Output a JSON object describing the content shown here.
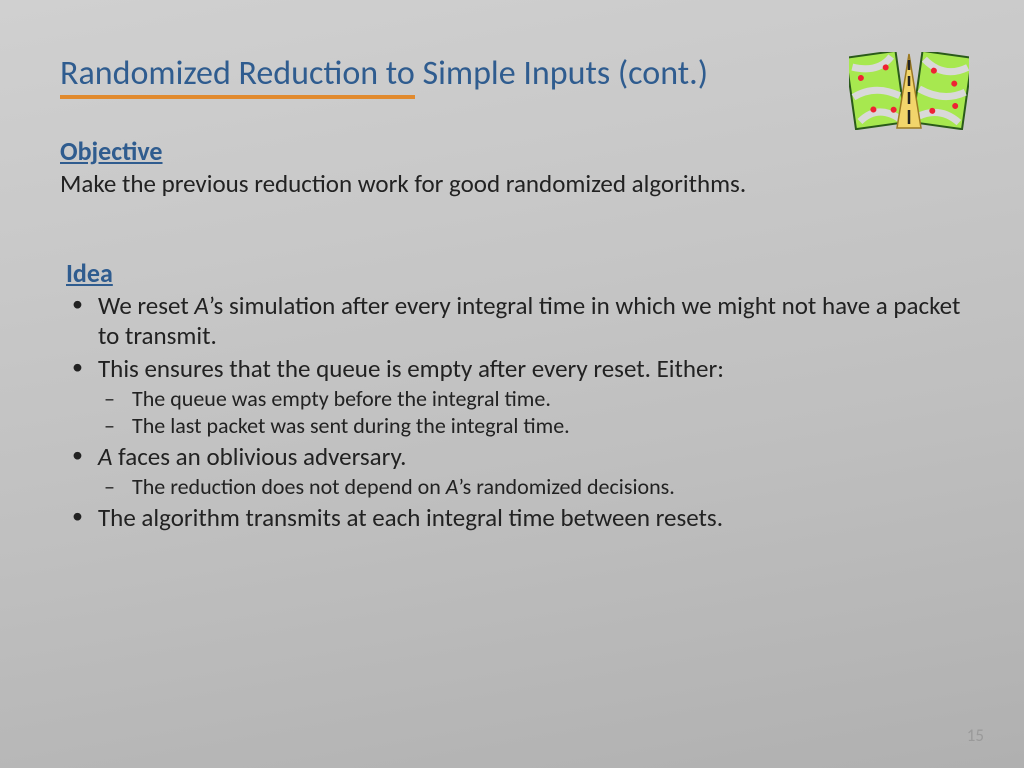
{
  "title": {
    "first": "Randomized Reduction to",
    "rest": " Simple Inputs (cont.)"
  },
  "objective": {
    "head": "Objective",
    "body": "Make the previous reduction work for good randomized algorithms."
  },
  "idea": {
    "head": "Idea",
    "bullets": {
      "b1a": "We reset ",
      "b1i": "A",
      "b1b": "’s simulation after every integral time in which we might not have a packet to transmit.",
      "b2": "This ensures that the queue is empty after every reset. Either:",
      "b2s1": "The queue was empty before the integral time.",
      "b2s2": "The last packet was sent during the integral time.",
      "b3i": "A",
      "b3b": " faces an oblivious adversary.",
      "b3s1a": "The reduction does not depend on ",
      "b3s1i": "A",
      "b3s1b": "’s randomized decisions.",
      "b4": "The algorithm transmits at each integral time between resets."
    }
  },
  "page": "15"
}
